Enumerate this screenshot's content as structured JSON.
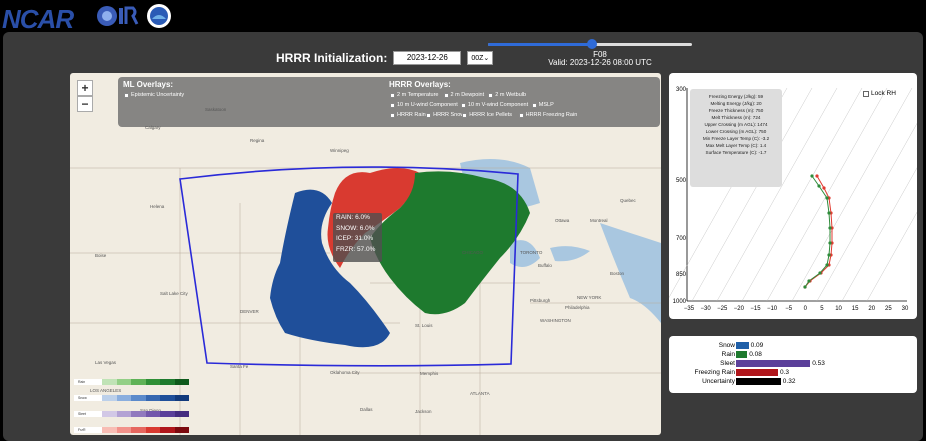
{
  "header": {
    "logo_text": "NCAR"
  },
  "controls": {
    "init_label": "HRRR Initialization:",
    "init_date": "2023-12-26",
    "cycle": "00Z",
    "forecast_hour": "F08",
    "valid_time": "Valid: 2023-12-26 08:00 UTC",
    "slider_fraction": 0.51
  },
  "map": {
    "zoom_in": "+",
    "zoom_out": "−",
    "ml_overlays_title": "ML Overlays:",
    "ml_overlays": [
      "Epistemic Uncertainty"
    ],
    "hrrr_overlays_title": "HRRR Overlays:",
    "hrrr_overlays_row1": [
      "2 m Temperature",
      "2 m Dewpoint",
      "2 m Wetbulb"
    ],
    "hrrr_overlays_row2": [
      "10 m U-wind Component",
      "10 m V-wind Component",
      "MSLP"
    ],
    "hrrr_overlays_row3": [
      "HRRR Rain",
      "HRRR Snow",
      "HRRR Ice Pellets",
      "HRRR Freezing Rain"
    ],
    "tooltip": [
      "RAIN: 6.0%",
      "SNOW: 6.0%",
      "ICEP: 31.0%",
      "FRZR: 57.0%"
    ],
    "cities": [
      {
        "name": "Saskatoon",
        "cls": "c1"
      },
      {
        "name": "Calgary",
        "cls": "c2"
      },
      {
        "name": "Regina",
        "cls": "c3"
      },
      {
        "name": "Winnipeg",
        "cls": "c4"
      },
      {
        "name": "Helena",
        "cls": "c5"
      },
      {
        "name": "Boise",
        "cls": "c6"
      },
      {
        "name": "Salt Lake City",
        "cls": "c7"
      },
      {
        "name": "DENVER",
        "cls": "c8"
      },
      {
        "name": "Las Vegas",
        "cls": "c9"
      },
      {
        "name": "LOS ANGELES",
        "cls": "c10"
      },
      {
        "name": "San Diego",
        "cls": "c11"
      },
      {
        "name": "Santa Fe",
        "cls": "c12"
      },
      {
        "name": "Oklahoma City",
        "cls": "c13"
      },
      {
        "name": "Dallas",
        "cls": "c14"
      },
      {
        "name": "Jackson",
        "cls": "c15"
      },
      {
        "name": "ATLANTA",
        "cls": "c16"
      },
      {
        "name": "Memphis",
        "cls": "c17"
      },
      {
        "name": "St. Louis",
        "cls": "c18"
      },
      {
        "name": "CHICAGO",
        "cls": "c19"
      },
      {
        "name": "TORONTO",
        "cls": "c20"
      },
      {
        "name": "Ottawa",
        "cls": "c21"
      },
      {
        "name": "Montreal",
        "cls": "c22"
      },
      {
        "name": "Quebec",
        "cls": "c23"
      },
      {
        "name": "Buffalo",
        "cls": "c24"
      },
      {
        "name": "Boston",
        "cls": "c25"
      },
      {
        "name": "NEW YORK",
        "cls": "c26"
      },
      {
        "name": "Pittsburgh",
        "cls": "c27"
      },
      {
        "name": "Philadelphia",
        "cls": "c28"
      },
      {
        "name": "WASHINGTON",
        "cls": "c29"
      }
    ],
    "legend_labels": [
      "Rain",
      "Snow",
      "Sleet",
      "FrzR"
    ]
  },
  "skewt": {
    "lock_rh": "Lock RH",
    "diagnostics": [
      "Freezing Energy (J/kg): 59",
      "Melting Energy (J/kg): 20",
      "Freeze Thickness (m): 750",
      "Melt Thickness (m): 724",
      "Upper Crossing (m AGL): 1474",
      "Lower Crossing (m AGL): 750",
      "Min Freeze Layer Temp (C): -3.2",
      "Max Melt Layer Temp (C): 1.4",
      "Surface Temperature (C): -1.7"
    ],
    "y_ticks": [
      "300",
      "500",
      "700",
      "850",
      "1000"
    ],
    "x_ticks": [
      "−35",
      "−30",
      "−25",
      "−20",
      "−15",
      "−10",
      "−5",
      "0",
      "5",
      "10",
      "15",
      "20",
      "25",
      "30"
    ]
  },
  "probabilities": {
    "items": [
      {
        "label": "Snow",
        "value": 0.09,
        "display": "0.09",
        "color": "#1f5fa8"
      },
      {
        "label": "Rain",
        "value": 0.08,
        "display": "0.08",
        "color": "#1e7a2e"
      },
      {
        "label": "Sleet",
        "value": 0.53,
        "display": "0.53",
        "color": "#5b3f9a"
      },
      {
        "label": "Freezing Rain",
        "value": 0.3,
        "display": "0.3",
        "color": "#b0161b"
      },
      {
        "label": "Uncertainty",
        "value": 0.32,
        "display": "0.32",
        "color": "#000000"
      }
    ]
  },
  "colors": {
    "rain": "#1e7a2e",
    "snow": "#1f4f9a",
    "sleet": "#5b3f9a",
    "frzr": "#d93a30",
    "domain_outline": "#2a2ad8"
  }
}
